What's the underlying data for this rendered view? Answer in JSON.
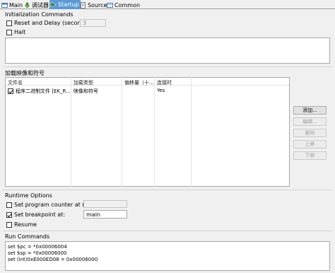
{
  "tabs": [
    {
      "label": "Main",
      "icon": "main-icon",
      "active": false
    },
    {
      "label": "调试器",
      "icon": "debugger-icon",
      "active": false
    },
    {
      "label": "Startup",
      "icon": "startup-icon",
      "active": true
    },
    {
      "label": "Source",
      "icon": "source-icon",
      "active": false
    },
    {
      "label": "Common",
      "icon": "common-icon",
      "active": false
    }
  ],
  "init": {
    "title": "Initialization Commands",
    "reset_label": "Reset and Delay (seconds):",
    "reset_checked": false,
    "delay_value": "3",
    "halt_label": "Halt",
    "halt_checked": false,
    "commands": ""
  },
  "load": {
    "title": "加载映像和符号",
    "columns": [
      "文件名",
      "加载类型",
      "偏移量（十...",
      "连接时"
    ],
    "rows": [
      {
        "checked": true,
        "file": "程序二进制文件 [EK_R...",
        "type": "映像和符号",
        "offset": "",
        "connect": "Yes"
      }
    ],
    "buttons": [
      {
        "label": "添加...",
        "enabled": true
      },
      {
        "label": "编辑...",
        "enabled": false
      },
      {
        "label": "删除",
        "enabled": false
      },
      {
        "label": "上移",
        "enabled": false
      },
      {
        "label": "下移",
        "enabled": false
      }
    ]
  },
  "runtime": {
    "title": "Runtime Options",
    "pc_label": "Set program counter at (hex):",
    "pc_checked": false,
    "pc_value": "",
    "bp_label": "Set breakpoint at:",
    "bp_checked": true,
    "bp_value": "main",
    "resume_label": "Resume",
    "resume_checked": false
  },
  "run": {
    "title": "Run Commands",
    "lines": [
      "set $pc = *0x00006004",
      "set $sp = *0x00006000",
      "set (int)0xE000ED08 = 0x00006000"
    ]
  },
  "colors": {
    "accent": "#5b9bd5",
    "panel_border": "#a9a9a9",
    "background": "#f0f0f0"
  }
}
